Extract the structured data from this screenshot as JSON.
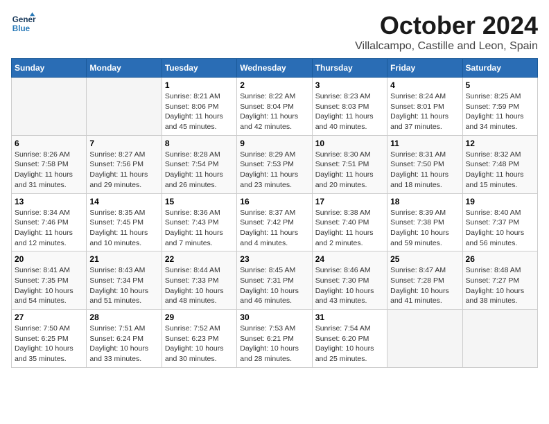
{
  "header": {
    "logo_line1": "General",
    "logo_line2": "Blue",
    "month": "October 2024",
    "location": "Villalcampo, Castille and Leon, Spain"
  },
  "weekdays": [
    "Sunday",
    "Monday",
    "Tuesday",
    "Wednesday",
    "Thursday",
    "Friday",
    "Saturday"
  ],
  "weeks": [
    [
      {
        "day": "",
        "detail": ""
      },
      {
        "day": "",
        "detail": ""
      },
      {
        "day": "1",
        "detail": "Sunrise: 8:21 AM\nSunset: 8:06 PM\nDaylight: 11 hours and 45 minutes."
      },
      {
        "day": "2",
        "detail": "Sunrise: 8:22 AM\nSunset: 8:04 PM\nDaylight: 11 hours and 42 minutes."
      },
      {
        "day": "3",
        "detail": "Sunrise: 8:23 AM\nSunset: 8:03 PM\nDaylight: 11 hours and 40 minutes."
      },
      {
        "day": "4",
        "detail": "Sunrise: 8:24 AM\nSunset: 8:01 PM\nDaylight: 11 hours and 37 minutes."
      },
      {
        "day": "5",
        "detail": "Sunrise: 8:25 AM\nSunset: 7:59 PM\nDaylight: 11 hours and 34 minutes."
      }
    ],
    [
      {
        "day": "6",
        "detail": "Sunrise: 8:26 AM\nSunset: 7:58 PM\nDaylight: 11 hours and 31 minutes."
      },
      {
        "day": "7",
        "detail": "Sunrise: 8:27 AM\nSunset: 7:56 PM\nDaylight: 11 hours and 29 minutes."
      },
      {
        "day": "8",
        "detail": "Sunrise: 8:28 AM\nSunset: 7:54 PM\nDaylight: 11 hours and 26 minutes."
      },
      {
        "day": "9",
        "detail": "Sunrise: 8:29 AM\nSunset: 7:53 PM\nDaylight: 11 hours and 23 minutes."
      },
      {
        "day": "10",
        "detail": "Sunrise: 8:30 AM\nSunset: 7:51 PM\nDaylight: 11 hours and 20 minutes."
      },
      {
        "day": "11",
        "detail": "Sunrise: 8:31 AM\nSunset: 7:50 PM\nDaylight: 11 hours and 18 minutes."
      },
      {
        "day": "12",
        "detail": "Sunrise: 8:32 AM\nSunset: 7:48 PM\nDaylight: 11 hours and 15 minutes."
      }
    ],
    [
      {
        "day": "13",
        "detail": "Sunrise: 8:34 AM\nSunset: 7:46 PM\nDaylight: 11 hours and 12 minutes."
      },
      {
        "day": "14",
        "detail": "Sunrise: 8:35 AM\nSunset: 7:45 PM\nDaylight: 11 hours and 10 minutes."
      },
      {
        "day": "15",
        "detail": "Sunrise: 8:36 AM\nSunset: 7:43 PM\nDaylight: 11 hours and 7 minutes."
      },
      {
        "day": "16",
        "detail": "Sunrise: 8:37 AM\nSunset: 7:42 PM\nDaylight: 11 hours and 4 minutes."
      },
      {
        "day": "17",
        "detail": "Sunrise: 8:38 AM\nSunset: 7:40 PM\nDaylight: 11 hours and 2 minutes."
      },
      {
        "day": "18",
        "detail": "Sunrise: 8:39 AM\nSunset: 7:38 PM\nDaylight: 10 hours and 59 minutes."
      },
      {
        "day": "19",
        "detail": "Sunrise: 8:40 AM\nSunset: 7:37 PM\nDaylight: 10 hours and 56 minutes."
      }
    ],
    [
      {
        "day": "20",
        "detail": "Sunrise: 8:41 AM\nSunset: 7:35 PM\nDaylight: 10 hours and 54 minutes."
      },
      {
        "day": "21",
        "detail": "Sunrise: 8:43 AM\nSunset: 7:34 PM\nDaylight: 10 hours and 51 minutes."
      },
      {
        "day": "22",
        "detail": "Sunrise: 8:44 AM\nSunset: 7:33 PM\nDaylight: 10 hours and 48 minutes."
      },
      {
        "day": "23",
        "detail": "Sunrise: 8:45 AM\nSunset: 7:31 PM\nDaylight: 10 hours and 46 minutes."
      },
      {
        "day": "24",
        "detail": "Sunrise: 8:46 AM\nSunset: 7:30 PM\nDaylight: 10 hours and 43 minutes."
      },
      {
        "day": "25",
        "detail": "Sunrise: 8:47 AM\nSunset: 7:28 PM\nDaylight: 10 hours and 41 minutes."
      },
      {
        "day": "26",
        "detail": "Sunrise: 8:48 AM\nSunset: 7:27 PM\nDaylight: 10 hours and 38 minutes."
      }
    ],
    [
      {
        "day": "27",
        "detail": "Sunrise: 7:50 AM\nSunset: 6:25 PM\nDaylight: 10 hours and 35 minutes."
      },
      {
        "day": "28",
        "detail": "Sunrise: 7:51 AM\nSunset: 6:24 PM\nDaylight: 10 hours and 33 minutes."
      },
      {
        "day": "29",
        "detail": "Sunrise: 7:52 AM\nSunset: 6:23 PM\nDaylight: 10 hours and 30 minutes."
      },
      {
        "day": "30",
        "detail": "Sunrise: 7:53 AM\nSunset: 6:21 PM\nDaylight: 10 hours and 28 minutes."
      },
      {
        "day": "31",
        "detail": "Sunrise: 7:54 AM\nSunset: 6:20 PM\nDaylight: 10 hours and 25 minutes."
      },
      {
        "day": "",
        "detail": ""
      },
      {
        "day": "",
        "detail": ""
      }
    ]
  ]
}
